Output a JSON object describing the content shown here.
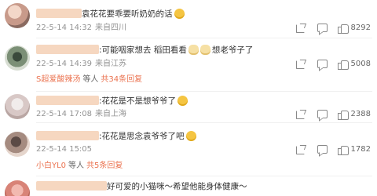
{
  "comments": [
    {
      "text_suffix": "袁花花要乖要听奶奶的话",
      "meta": {
        "date": "22-5-14 14:32",
        "location": "来自四川"
      },
      "likes": "8292",
      "reply": null
    },
    {
      "text_suffix": ":可能咽家想去 稻田看看",
      "text_suffix_2": "想老爷子了",
      "meta": {
        "date": "22-5-14 14:39",
        "location": "来自江苏"
      },
      "likes": "5008",
      "reply": {
        "name": "S超爱酸辣汤",
        "middle": "等人",
        "link": "共34条回复"
      }
    },
    {
      "text_suffix": ":花花是不是想爷爷了",
      "meta": {
        "date": "22-5-14 17:08",
        "location": "来自上海"
      },
      "likes": "2388",
      "reply": null
    },
    {
      "text_suffix": ":花花是思念袁爷爷了吧",
      "meta": {
        "date": "22-5-14 15:05",
        "location": ""
      },
      "likes": "1782",
      "reply": {
        "name": "小白YL0",
        "middle": "等人",
        "link": "共5条回复"
      }
    },
    {
      "text_suffix": "好可爱的小猫咪～希望他能身体健康～",
      "meta": {
        "date": "",
        "location": ""
      },
      "likes": "",
      "reply": null
    }
  ]
}
